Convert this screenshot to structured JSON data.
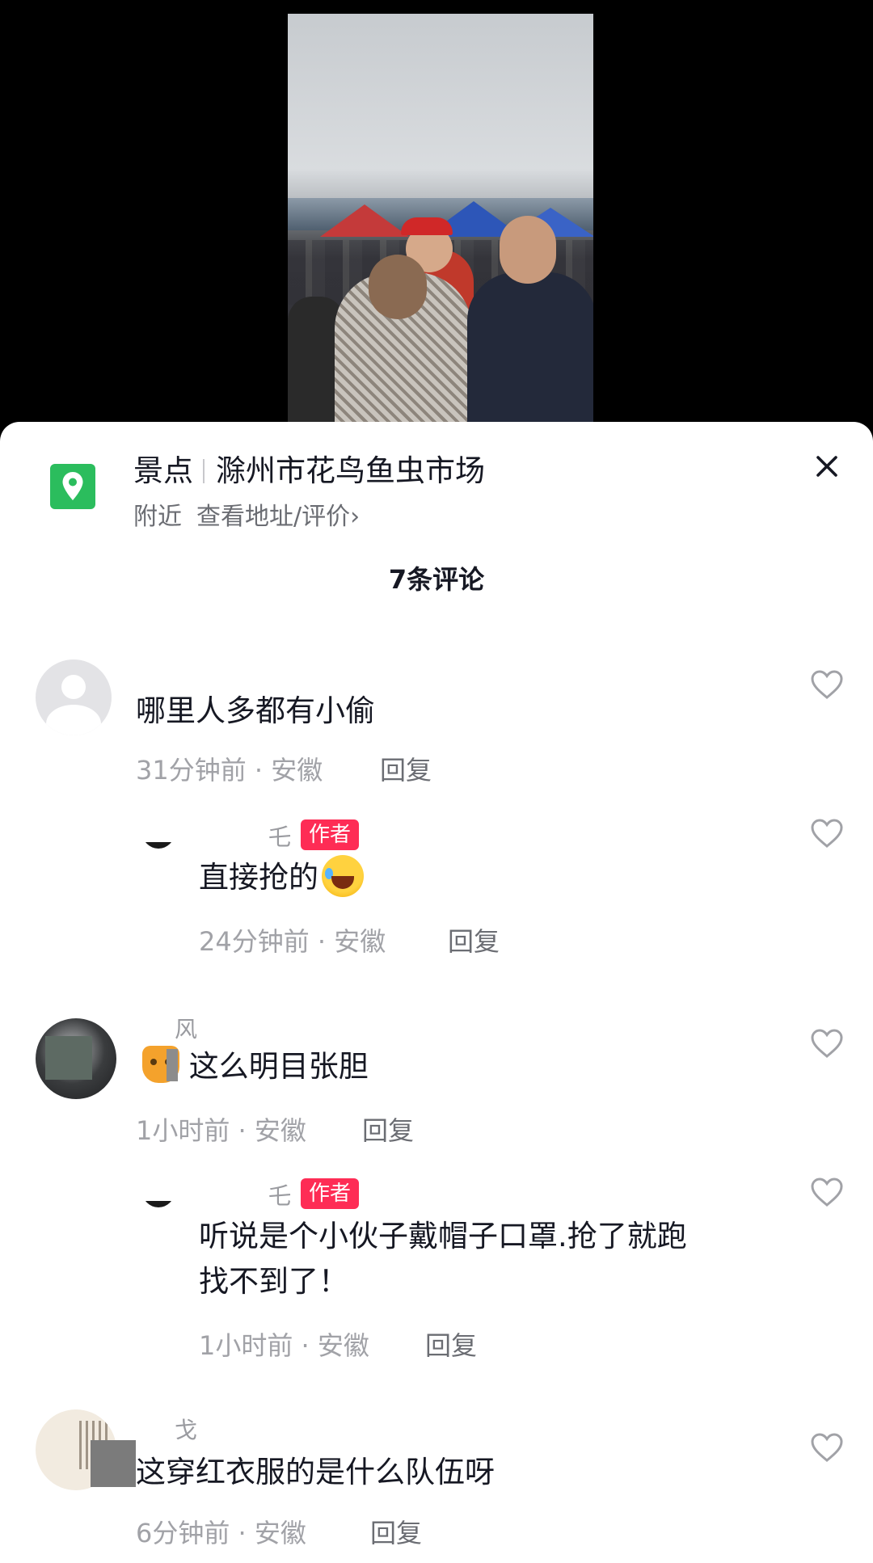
{
  "poi": {
    "category": "景点",
    "name": "滁州市花鸟鱼虫市场",
    "nearby": "附近",
    "link": "查看地址/评价",
    "chevron": "›"
  },
  "comment_count": "7条评论",
  "comments": [
    {
      "username": "",
      "text": "哪里人多都有小偷",
      "time": "31分钟前 · 安徽",
      "reply": "回复"
    },
    {
      "username": "乇",
      "badge": "作者",
      "text": "直接抢的",
      "time": "24分钟前 · 安徽",
      "reply": "回复"
    },
    {
      "username": "风",
      "text": "这么明目张胆",
      "time": "1小时前 · 安徽",
      "reply": "回复"
    },
    {
      "username": "乇",
      "badge": "作者",
      "text_line1": "听说是个小伙子戴帽子口罩.抢了就跑",
      "text_line2": "找不到了！",
      "time": "1小时前 · 安徽",
      "reply": "回复"
    },
    {
      "username": "戈",
      "text": "这穿红衣服的是什么队伍呀",
      "time": "6分钟前 · 安徽",
      "reply": "回复"
    }
  ],
  "colors": {
    "accent_author": "#fe2c55",
    "poi_icon": "#2bbd5d"
  },
  "icons": [
    "location-pin-icon",
    "close-icon",
    "heart-outline-icon"
  ]
}
